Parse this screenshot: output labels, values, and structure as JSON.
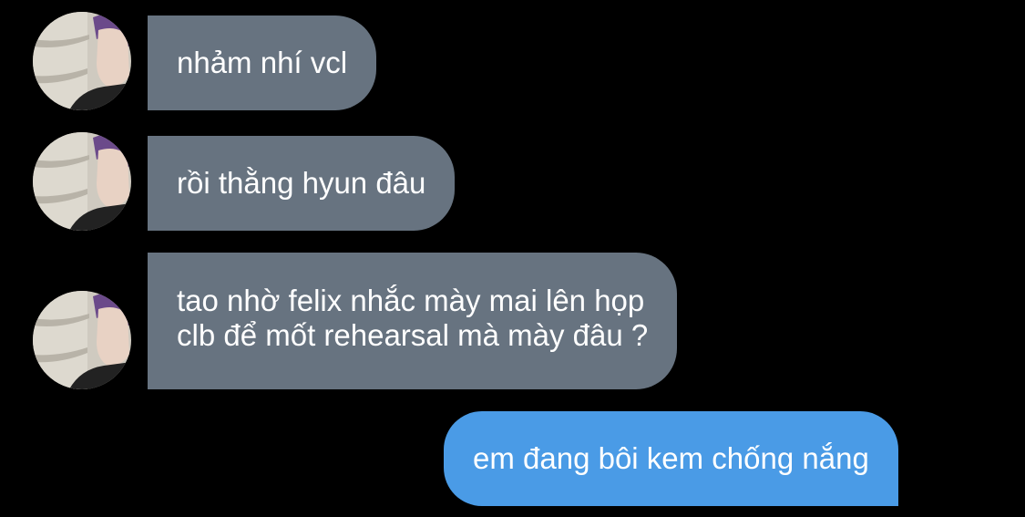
{
  "conversation": {
    "messages": [
      {
        "sender": "other",
        "lines": [
          "nhảm nhí vcl"
        ]
      },
      {
        "sender": "other",
        "lines": [
          "rồi thằng hyun đâu"
        ]
      },
      {
        "sender": "other",
        "lines": [
          "tao nhờ felix nhắc mày mai lên họp",
          "clb để mốt rehearsal mà mày đâu ?"
        ]
      },
      {
        "sender": "me",
        "lines": [
          "em đang bôi kem chống nắng"
        ]
      }
    ]
  },
  "colors": {
    "background": "#000000",
    "incoming_bubble": "#677380",
    "outgoing_bubble": "#4a9be6",
    "text": "#ffffff"
  },
  "icons": {
    "contact_avatar": "avatar-photo"
  }
}
